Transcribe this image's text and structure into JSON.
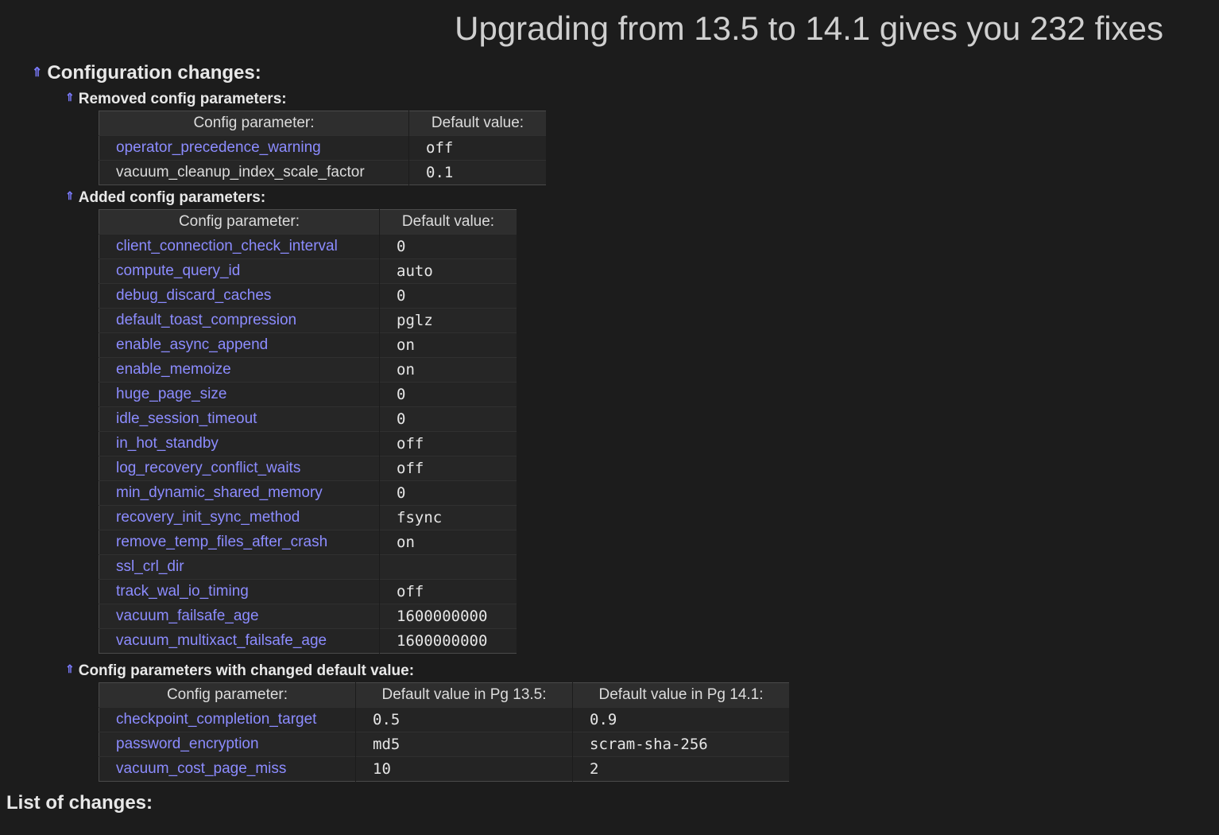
{
  "title": "Upgrading from 13.5 to 14.1 gives you 232 fixes",
  "config_changes": {
    "heading": "Configuration changes:",
    "up_arrow": "⇑",
    "removed": {
      "heading": "Removed config parameters:",
      "columns": [
        "Config parameter:",
        "Default value:"
      ],
      "rows": [
        {
          "param": "operator_precedence_warning",
          "value": "off",
          "link": true
        },
        {
          "param": "vacuum_cleanup_index_scale_factor",
          "value": "0.1",
          "link": false
        }
      ]
    },
    "added": {
      "heading": "Added config parameters:",
      "columns": [
        "Config parameter:",
        "Default value:"
      ],
      "rows": [
        {
          "param": "client_connection_check_interval",
          "value": "0"
        },
        {
          "param": "compute_query_id",
          "value": "auto"
        },
        {
          "param": "debug_discard_caches",
          "value": "0"
        },
        {
          "param": "default_toast_compression",
          "value": "pglz"
        },
        {
          "param": "enable_async_append",
          "value": "on"
        },
        {
          "param": "enable_memoize",
          "value": "on"
        },
        {
          "param": "huge_page_size",
          "value": "0"
        },
        {
          "param": "idle_session_timeout",
          "value": "0"
        },
        {
          "param": "in_hot_standby",
          "value": "off"
        },
        {
          "param": "log_recovery_conflict_waits",
          "value": "off"
        },
        {
          "param": "min_dynamic_shared_memory",
          "value": "0"
        },
        {
          "param": "recovery_init_sync_method",
          "value": "fsync"
        },
        {
          "param": "remove_temp_files_after_crash",
          "value": "on"
        },
        {
          "param": "ssl_crl_dir",
          "value": ""
        },
        {
          "param": "track_wal_io_timing",
          "value": "off"
        },
        {
          "param": "vacuum_failsafe_age",
          "value": "1600000000"
        },
        {
          "param": "vacuum_multixact_failsafe_age",
          "value": "1600000000"
        }
      ]
    },
    "changed": {
      "heading": "Config parameters with changed default value:",
      "columns": [
        "Config parameter:",
        "Default value in Pg 13.5:",
        "Default value in Pg 14.1:"
      ],
      "rows": [
        {
          "param": "checkpoint_completion_target",
          "old": "0.5",
          "new": "0.9"
        },
        {
          "param": "password_encryption",
          "old": "md5",
          "new": "scram-sha-256"
        },
        {
          "param": "vacuum_cost_page_miss",
          "old": "10",
          "new": "2"
        }
      ]
    }
  },
  "list_heading": "List of changes:",
  "colors": {
    "background": "#1c1c1c",
    "link": "#8c8cff",
    "arrow": "#7b7bff"
  }
}
